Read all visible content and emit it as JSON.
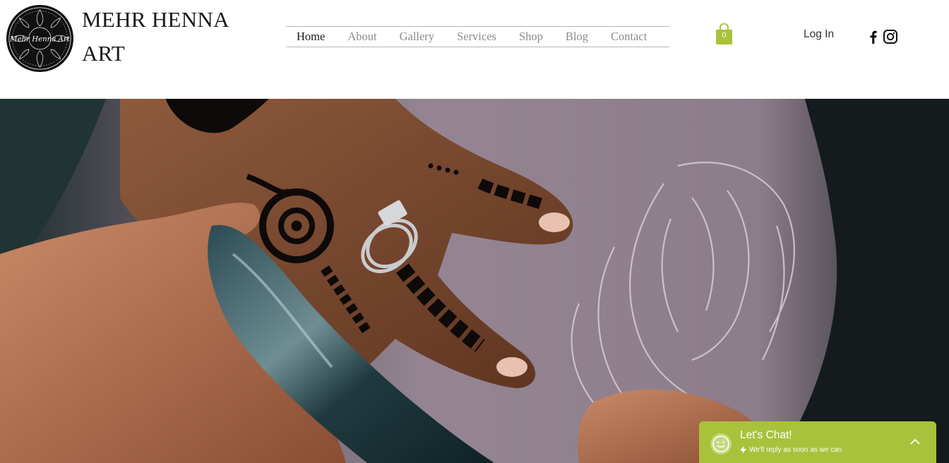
{
  "brand": {
    "logo_text": "Mehr Henna Art",
    "title_line1": "MEHR HENNA",
    "title_line2": "ART"
  },
  "nav": {
    "items": [
      {
        "label": "Home",
        "active": true
      },
      {
        "label": "About"
      },
      {
        "label": "Gallery"
      },
      {
        "label": "Services"
      },
      {
        "label": "Shop"
      },
      {
        "label": "Blog"
      },
      {
        "label": "Contact"
      }
    ]
  },
  "cart": {
    "count": "0",
    "icon": "shopping-bag-icon",
    "color": "#a9c23b"
  },
  "auth": {
    "login_label": "Log In"
  },
  "social": [
    {
      "name": "facebook-icon"
    },
    {
      "name": "instagram-icon"
    }
  ],
  "hero": {
    "subject": "henna-hand-photo"
  },
  "chat": {
    "title": "Let's Chat!",
    "subtitle": "We'll reply as soon as we can",
    "color": "#a9c23b"
  }
}
